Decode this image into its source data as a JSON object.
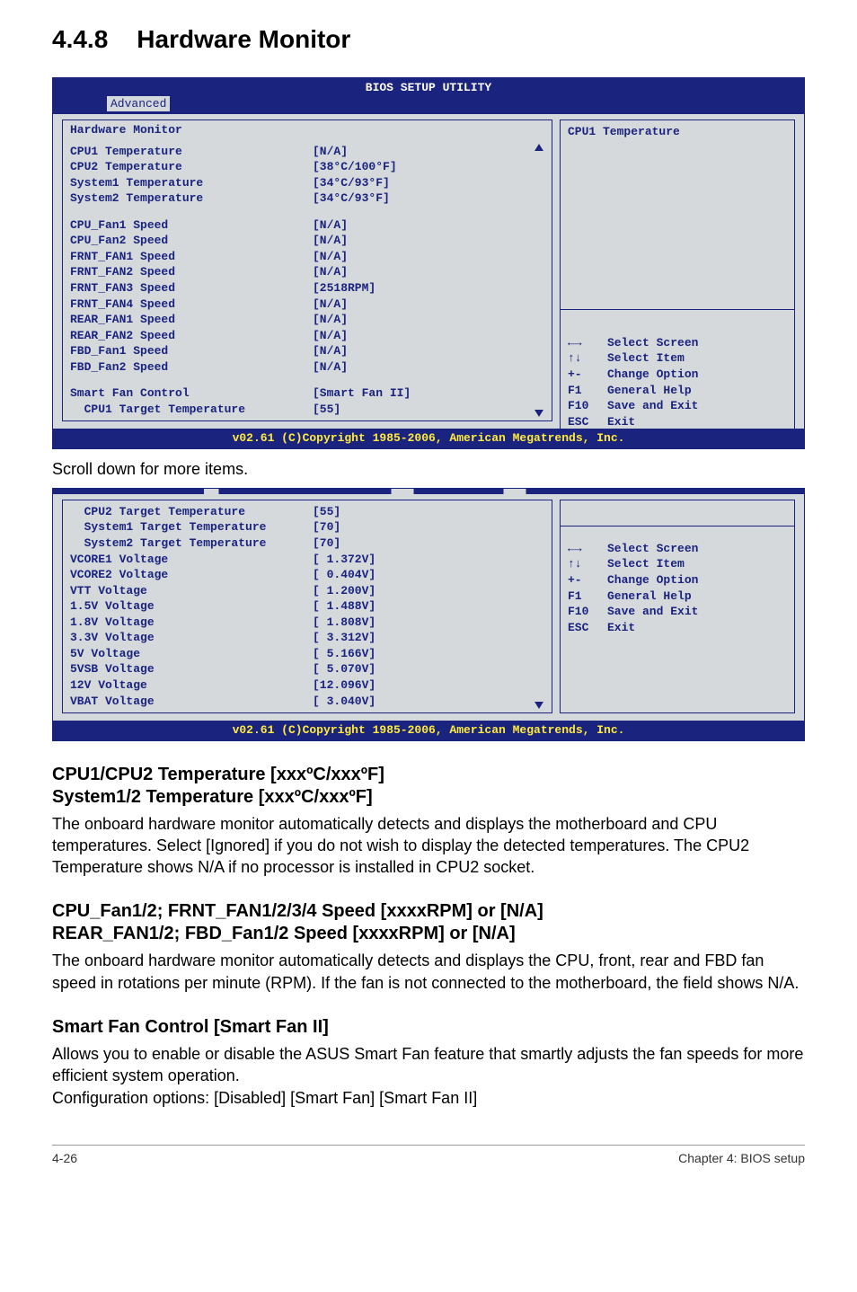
{
  "heading": {
    "num": "4.4.8",
    "title": "Hardware Monitor"
  },
  "bios1": {
    "title": "BIOS SETUP UTILITY",
    "tab": "Advanced",
    "panel_title": "Hardware Monitor",
    "right_top": "CPU1 Temperature",
    "rows_a": [
      {
        "k": "CPU1 Temperature",
        "v": "[N/A]"
      },
      {
        "k": "CPU2 Temperature",
        "v": "[38°C/100°F]"
      },
      {
        "k": "System1 Temperature",
        "v": "[34°C/93°F]"
      },
      {
        "k": "System2 Temperature",
        "v": "[34°C/93°F]"
      }
    ],
    "rows_b": [
      {
        "k": "CPU_Fan1 Speed",
        "v": "[N/A]"
      },
      {
        "k": "CPU_Fan2 Speed",
        "v": "[N/A]"
      },
      {
        "k": "FRNT_FAN1 Speed",
        "v": "[N/A]"
      },
      {
        "k": "FRNT_FAN2 Speed",
        "v": "[N/A]"
      },
      {
        "k": "FRNT_FAN3 Speed",
        "v": "[2518RPM]"
      },
      {
        "k": "FRNT_FAN4 Speed",
        "v": "[N/A]"
      },
      {
        "k": "REAR_FAN1 Speed",
        "v": "[N/A]"
      },
      {
        "k": "REAR_FAN2 Speed",
        "v": "[N/A]"
      },
      {
        "k": "FBD_Fan1 Speed",
        "v": "[N/A]"
      },
      {
        "k": "FBD_Fan2 Speed",
        "v": "[N/A]"
      }
    ],
    "rows_c": [
      {
        "k": "Smart Fan Control",
        "v": "[Smart Fan II]"
      },
      {
        "k": "  CPU1 Target Temperature",
        "v": "[55]"
      }
    ],
    "help": [
      {
        "k": "←→",
        "v": "Select Screen"
      },
      {
        "k": "↑↓",
        "v": "Select Item"
      },
      {
        "k": "+-",
        "v": "Change Option"
      },
      {
        "k": "F1",
        "v": "General Help"
      },
      {
        "k": "F10",
        "v": "Save and Exit"
      },
      {
        "k": "ESC",
        "v": "Exit"
      }
    ],
    "footer": "v02.61 (C)Copyright 1985-2006, American Megatrends, Inc."
  },
  "caption1": "Scroll down for more items.",
  "bios2": {
    "rows": [
      {
        "k": "  CPU2 Target Temperature",
        "v": "[55]"
      },
      {
        "k": "  System1 Target Temperature",
        "v": "[70]"
      },
      {
        "k": "  System2 Target Temperature",
        "v": "[70]"
      },
      {
        "k": "VCORE1 Voltage",
        "v": "[ 1.372V]"
      },
      {
        "k": "VCORE2 Voltage",
        "v": "[ 0.404V]"
      },
      {
        "k": "VTT Voltage",
        "v": "[ 1.200V]"
      },
      {
        "k": "1.5V Voltage",
        "v": "[ 1.488V]"
      },
      {
        "k": "1.8V Voltage",
        "v": "[ 1.808V]"
      },
      {
        "k": "3.3V Voltage",
        "v": "[ 3.312V]"
      },
      {
        "k": "5V Voltage",
        "v": "[ 5.166V]"
      },
      {
        "k": "5VSB Voltage",
        "v": "[ 5.070V]"
      },
      {
        "k": "12V Voltage",
        "v": "[12.096V]"
      },
      {
        "k": "VBAT Voltage",
        "v": "[ 3.040V]"
      }
    ],
    "help": [
      {
        "k": "←→",
        "v": "Select Screen"
      },
      {
        "k": "↑↓",
        "v": "Select Item"
      },
      {
        "k": "+-",
        "v": "Change Option"
      },
      {
        "k": "F1",
        "v": "General Help"
      },
      {
        "k": "F10",
        "v": "Save and Exit"
      },
      {
        "k": "ESC",
        "v": "Exit"
      }
    ],
    "footer": "v02.61 (C)Copyright 1985-2006, American Megatrends, Inc."
  },
  "sections": {
    "s1_h1": "CPU1/CPU2 Temperature [xxxºC/xxxºF]",
    "s1_h2": "System1/2 Temperature [xxxºC/xxxºF]",
    "s1_body": "The onboard hardware monitor automatically detects and displays the motherboard and CPU temperatures. Select [Ignored] if you do not wish to display the detected temperatures. The CPU2 Temperature shows N/A if no processor is installed in CPU2 socket.",
    "s2_h1": "CPU_Fan1/2; FRNT_FAN1/2/3/4 Speed [xxxxRPM] or [N/A]",
    "s2_h2": "REAR_FAN1/2; FBD_Fan1/2 Speed [xxxxRPM] or [N/A]",
    "s2_body": "The onboard hardware monitor automatically detects and displays the CPU, front, rear and FBD fan speed in rotations per minute (RPM). If the fan is not connected to the motherboard, the field shows N/A.",
    "s3_h": "Smart Fan Control [Smart Fan II]",
    "s3_body1": "Allows you to enable or disable the ASUS Smart Fan feature that smartly adjusts the fan speeds for more efficient system operation.",
    "s3_body2": "Configuration options: [Disabled] [Smart Fan] [Smart Fan II]"
  },
  "footer": {
    "left": "4-26",
    "right": "Chapter 4: BIOS setup"
  }
}
